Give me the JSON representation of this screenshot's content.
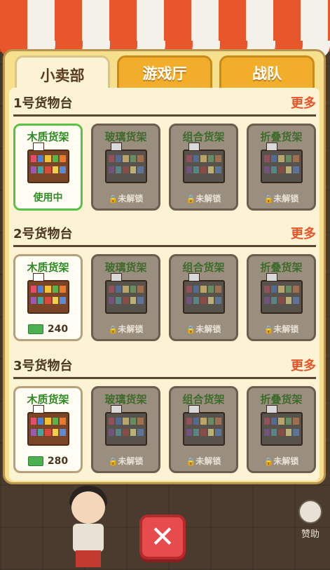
{
  "tabs": [
    {
      "label": "小卖部",
      "active": true
    },
    {
      "label": "游戏厅",
      "active": false
    },
    {
      "label": "战队",
      "active": false
    }
  ],
  "sections": [
    {
      "title": "1号货物台",
      "more": "更多",
      "cards": [
        {
          "name": "木质货架",
          "state": "owned",
          "footer": "使用中"
        },
        {
          "name": "玻璃货架",
          "state": "locked",
          "footer": "未解锁"
        },
        {
          "name": "组合货架",
          "state": "locked",
          "footer": "未解锁"
        },
        {
          "name": "折叠货架",
          "state": "locked",
          "footer": "未解锁"
        }
      ]
    },
    {
      "title": "2号货物台",
      "more": "更多",
      "cards": [
        {
          "name": "木质货架",
          "state": "buy",
          "footer": "240"
        },
        {
          "name": "玻璃货架",
          "state": "locked",
          "footer": "未解锁"
        },
        {
          "name": "组合货架",
          "state": "locked",
          "footer": "未解锁"
        },
        {
          "name": "折叠货架",
          "state": "locked",
          "footer": "未解锁"
        }
      ]
    },
    {
      "title": "3号货物台",
      "more": "更多",
      "cards": [
        {
          "name": "木质货架",
          "state": "buy",
          "footer": "280"
        },
        {
          "name": "玻璃货架",
          "state": "locked",
          "footer": "未解锁"
        },
        {
          "name": "组合货架",
          "state": "locked",
          "footer": "未解锁"
        },
        {
          "name": "折叠货架",
          "state": "locked",
          "footer": "未解锁"
        }
      ]
    }
  ],
  "side_button": {
    "label": "赞助"
  },
  "colors": {
    "accent": "#e8542a",
    "owned_border": "#5ac146",
    "panel": "#f6e08e"
  }
}
